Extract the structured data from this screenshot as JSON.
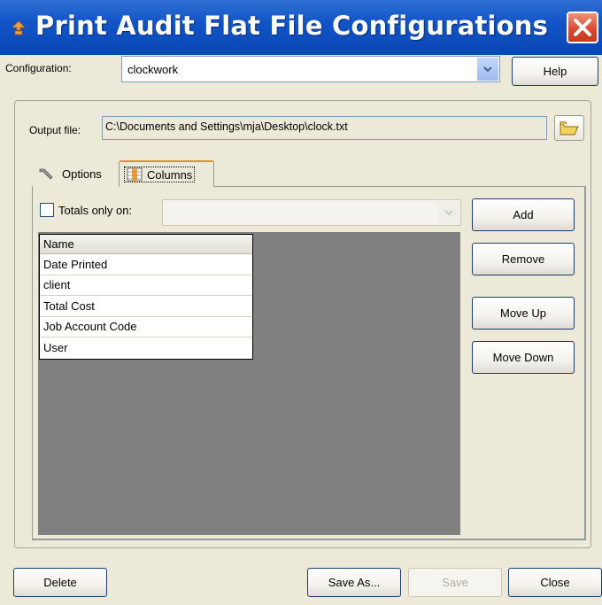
{
  "window": {
    "title": "Print Audit Flat File Configurations",
    "close_icon": "close-x-icon",
    "app_icon": "print-audit-icon"
  },
  "config": {
    "label": "Configuration:",
    "value": "clockwork",
    "help_label": "Help"
  },
  "output": {
    "label": "Output file:",
    "value": "C:\\Documents and Settings\\mja\\Desktop\\clock.txt",
    "browse_icon": "folder-icon"
  },
  "tabs": [
    {
      "label": "Options",
      "icon": "wrench-icon",
      "active": false
    },
    {
      "label": "Columns",
      "icon": "columns-icon",
      "active": true
    }
  ],
  "totals": {
    "label": "Totals only on:",
    "checked": false,
    "value": ""
  },
  "grid": {
    "header": "Name",
    "rows": [
      "Date Printed",
      "client",
      "Total Cost",
      "Job Account Code",
      "User"
    ]
  },
  "side_buttons": {
    "add": "Add",
    "remove": "Remove",
    "move_up": "Move Up",
    "move_down": "Move Down"
  },
  "footer": {
    "delete": "Delete",
    "save_as": "Save As...",
    "save": "Save",
    "close": "Close"
  },
  "colors": {
    "titlebar": "#0a46b3",
    "close_button": "#d8462a",
    "tab_highlight": "#e68b2c",
    "grid_background": "#808080"
  }
}
